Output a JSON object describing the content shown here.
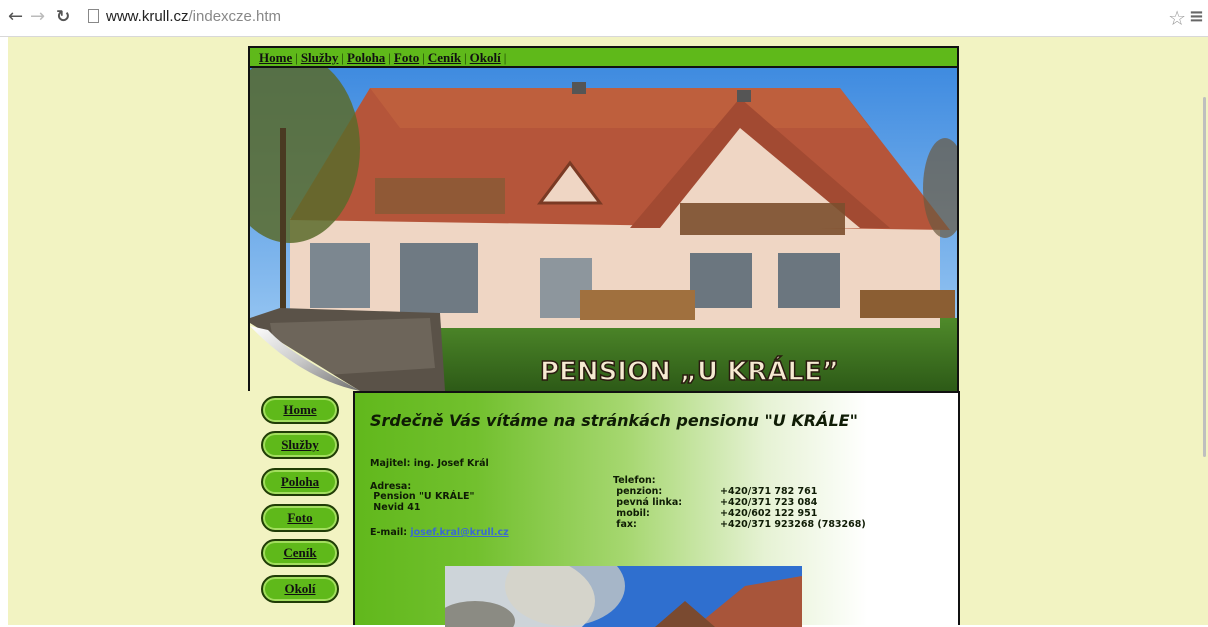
{
  "browser": {
    "url_host": "www.krull.cz",
    "url_path": "/indexcze.htm"
  },
  "topnav": {
    "items": [
      "Home",
      "Služby",
      "Poloha",
      "Foto",
      "Ceník",
      "Okolí"
    ]
  },
  "banner": {
    "title": "PENSION „U KRÁLE”"
  },
  "sidebar": {
    "items": [
      "Home",
      "Služby",
      "Poloha",
      "Foto",
      "Ceník",
      "Okolí"
    ]
  },
  "content": {
    "welcome": "Srdečně Vás vítáme na stránkách pensionu \"U KRÁLE\"",
    "owner": "Majitel: ing. Josef Král",
    "address_label": "Adresa:",
    "address_line1": " Pension \"U KRÁLE\"",
    "address_line2": " Nevid 41",
    "email_label": "E-mail: ",
    "email": "josef.kral@krull.cz",
    "phone_label": "Telefon:",
    "phones": [
      {
        "label": " penzion:",
        "number": "+420/371 782 761"
      },
      {
        "label": " pevná linka:",
        "number": "+420/371 723 084"
      },
      {
        "label": " mobil:",
        "number": "+420/602 122 951"
      },
      {
        "label": " fax:",
        "number": "+420/371 923268 (783268)"
      }
    ]
  },
  "colors": {
    "page_bg": "#f2f3c2",
    "accent_green": "#5fb91a",
    "border": "#111111"
  }
}
